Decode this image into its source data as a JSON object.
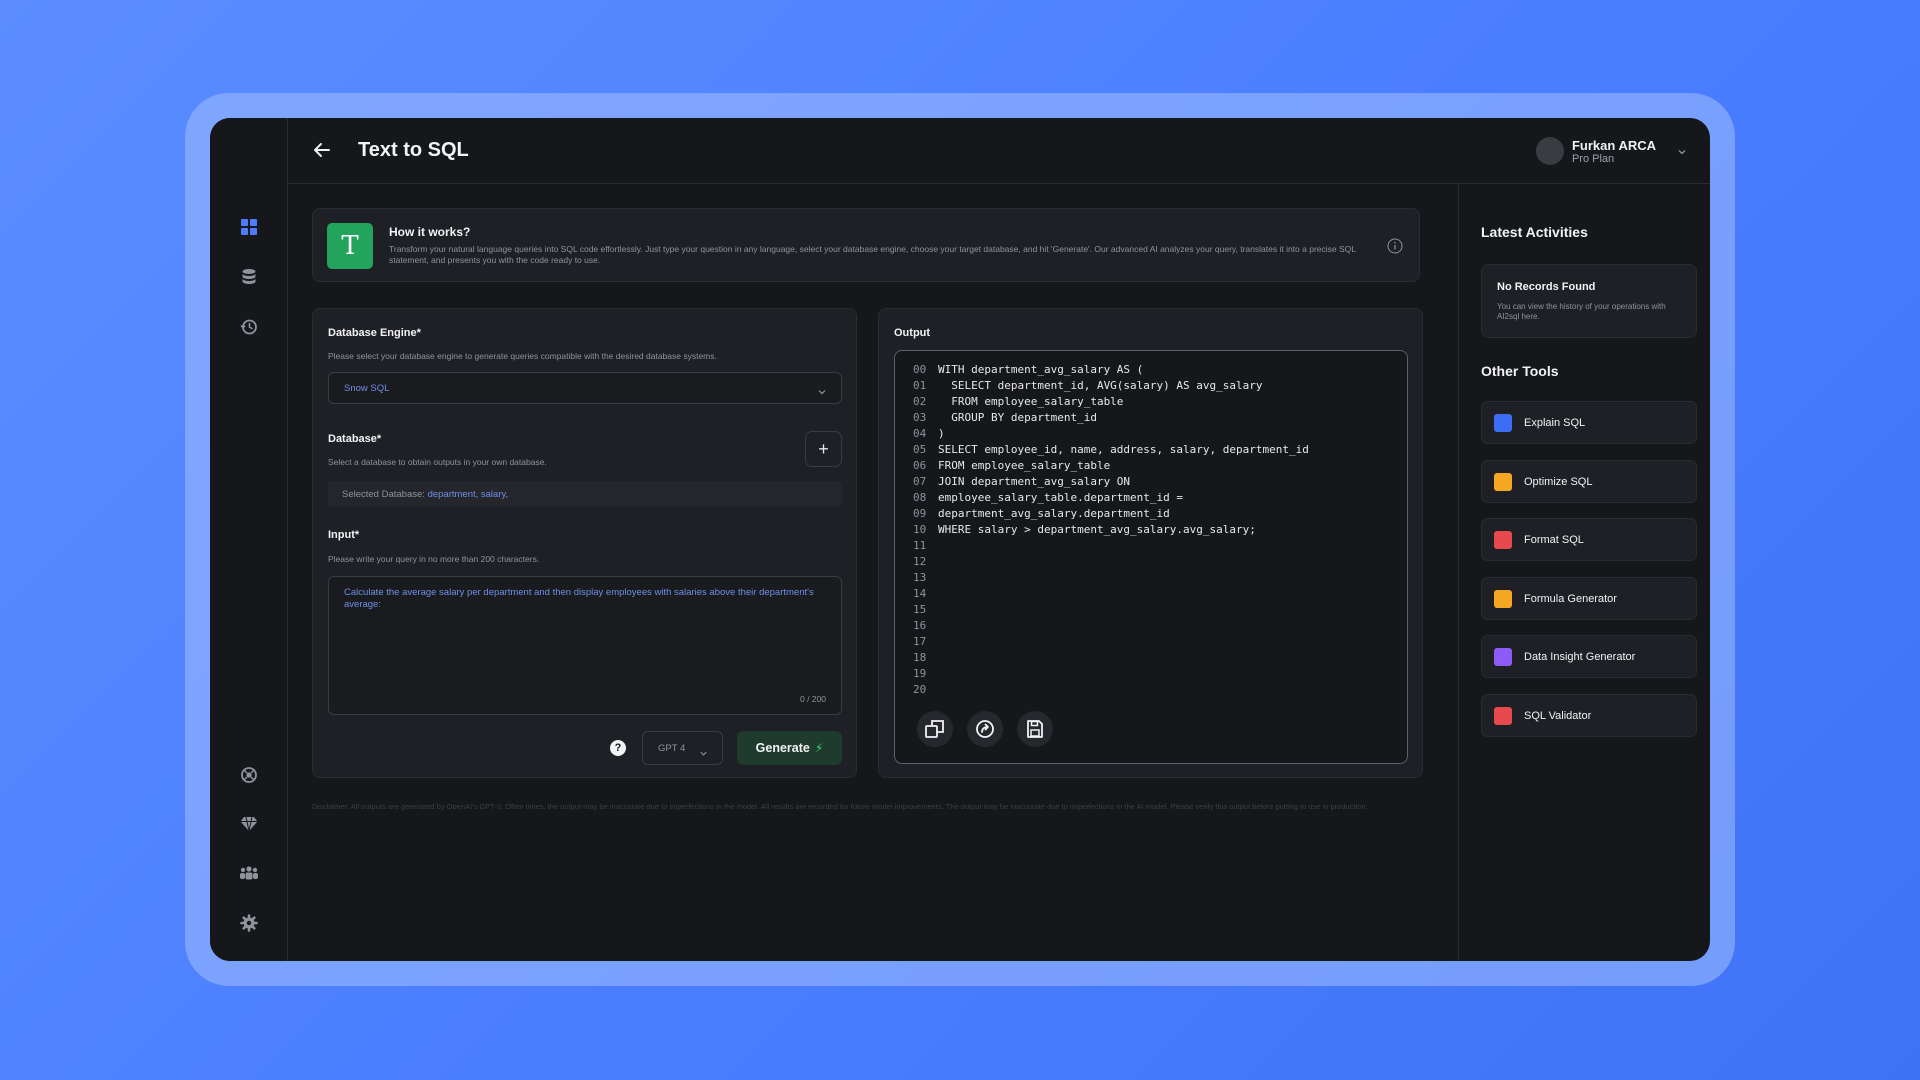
{
  "header": {
    "title": "Text to SQL",
    "user_name": "Furkan ARCA",
    "user_plan": "Pro Plan"
  },
  "sidebar": {
    "items": [
      "dashboard-icon",
      "database-icon",
      "history-icon",
      "globe-icon",
      "diamond-icon",
      "team-icon",
      "settings-icon"
    ],
    "active": "dashboard-icon"
  },
  "how_it_works": {
    "logo": "T",
    "title": "How it works?",
    "text": "Transform your natural language queries into SQL code effortlessly. Just type your question in any language, select your database engine, choose your target database, and hit 'Generate'. Our advanced AI analyzes your query, translates it into a precise SQL statement, and presents you with the code ready to use."
  },
  "form": {
    "engine_label": "Database Engine*",
    "engine_hint": "Please select your database engine to generate queries compatible with the desired database systems.",
    "engine_value": "Snow SQL",
    "database_label": "Database*",
    "database_hint": "Select a database to obtain outputs in your own database.",
    "selected_prefix": "Selected Database: ",
    "selected_value": "department, salary,",
    "input_label": "Input*",
    "input_hint": "Please write your query in no more than 200 characters.",
    "input_value": "Calculate the average salary per department  and then display employees with salaries above their department's average:",
    "char_count": "0 / 200",
    "model_value": "GPT 4",
    "generate_label": "Generate",
    "help": "?",
    "plus": "+"
  },
  "output": {
    "label": "Output",
    "lines": [
      {
        "n": "00",
        "code": "WITH department_avg_salary AS ("
      },
      {
        "n": "01",
        "code": "  SELECT department_id, AVG(salary) AS avg_salary"
      },
      {
        "n": "02",
        "code": "  FROM employee_salary_table"
      },
      {
        "n": "03",
        "code": "  GROUP BY department_id"
      },
      {
        "n": "04",
        "code": ")"
      },
      {
        "n": "05",
        "code": "SELECT employee_id, name, address, salary, department_id"
      },
      {
        "n": "06",
        "code": "FROM employee_salary_table"
      },
      {
        "n": "07",
        "code": "JOIN department_avg_salary ON"
      },
      {
        "n": "08",
        "code": "employee_salary_table.department_id ="
      },
      {
        "n": "09",
        "code": "department_avg_salary.department_id"
      },
      {
        "n": "10",
        "code": "WHERE salary > department_avg_salary.avg_salary;"
      },
      {
        "n": "11",
        "code": ""
      },
      {
        "n": "12",
        "code": ""
      },
      {
        "n": "13",
        "code": ""
      },
      {
        "n": "14",
        "code": ""
      },
      {
        "n": "15",
        "code": ""
      },
      {
        "n": "16",
        "code": ""
      },
      {
        "n": "17",
        "code": ""
      },
      {
        "n": "18",
        "code": ""
      },
      {
        "n": "19",
        "code": ""
      },
      {
        "n": "20",
        "code": ""
      }
    ]
  },
  "disclaimer": "Disclaimer: All outputs are generated by OpenAI's GPT-3. Often times, the output may be inaccurate due to imperfections in the model. All results are recorded for future model improvements. The output may be inaccurate due to imperfections in the AI model. Please verify this output before putting to use in production.",
  "aside": {
    "activities_title": "Latest Activities",
    "no_records_title": "No Records Found",
    "no_records_text": "You can view the history of your operations with AI2sql here.",
    "tools_title": "Other Tools",
    "tools": [
      {
        "label": "Explain SQL",
        "color": "#3b6ef5"
      },
      {
        "label": "Optimize SQL",
        "color": "#f5a623"
      },
      {
        "label": "Format SQL",
        "color": "#e5484d"
      },
      {
        "label": "Formula Generator",
        "color": "#f5a623"
      },
      {
        "label": "Data Insight Generator",
        "color": "#8b5cf6"
      },
      {
        "label": "SQL Validator",
        "color": "#e5484d"
      }
    ]
  },
  "colors": {
    "accent": "#6f8fe8",
    "generate_bg": "#1f3b2e",
    "logo_green": "#22a45d"
  }
}
